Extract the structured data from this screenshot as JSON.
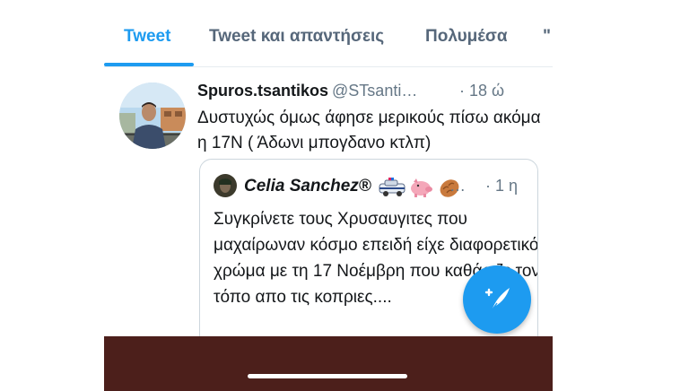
{
  "tabs": [
    {
      "label": "Tweet",
      "active": true
    },
    {
      "label": "Tweet και απαντήσεις",
      "active": false
    },
    {
      "label": "Πολυμέσα",
      "active": false
    },
    {
      "label": "\"",
      "active": false
    }
  ],
  "tweet": {
    "name": "Spuros.tsantikos",
    "handle": "@STsanti…",
    "time": "· 18 ώ",
    "text": "Δυστυχώς όμως άφησε μερικούς πίσω ακόμα η 17Ν ( Άδωνι μπογδανο κτλπ)"
  },
  "quoted": {
    "name": "Celia Sanchez®",
    "dots": "…",
    "time": "· 1 η",
    "text": "Συγκρίνετε τους Χρυσαυγιτες που μαχαίρωναν κόσμο επειδή είχε διαφορετικό χρώμα με τη 17 Νοέμβρη που καθάριζε τον τόπο απο τις κοπριες...."
  },
  "colors": {
    "accent": "#1d9bf0",
    "bottom_bar": "#4c1f1b"
  },
  "icons": {
    "more": "chevron-down-icon",
    "compose": "compose-tweet-icon"
  }
}
